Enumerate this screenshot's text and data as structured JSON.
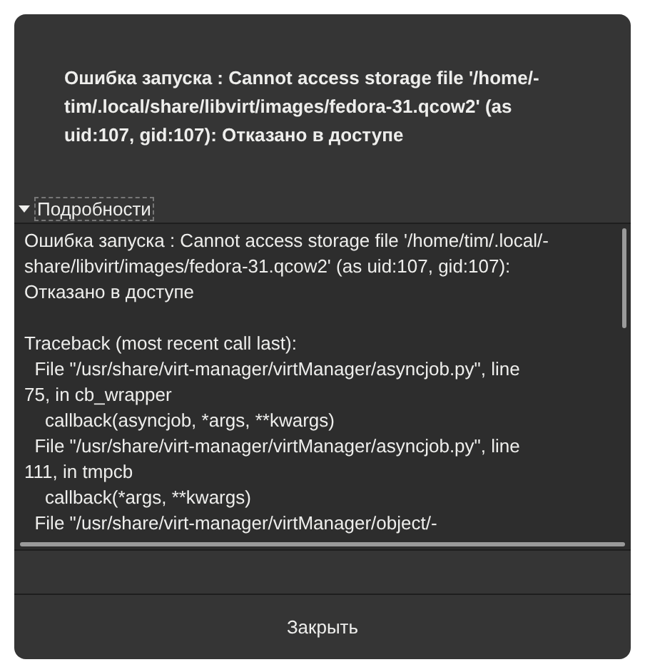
{
  "dialog": {
    "message": "Ошибка запуска : Cannot access storage file '/home/-\ntim/.local/share/libvirt/images/fedora-31.qcow2' (as\nuid:107, gid:107): Отказано в доступе",
    "details": {
      "label": "Подробности",
      "expanded": true,
      "text": "Ошибка запуска : Cannot access storage file '/home/tim/.local/-\nshare/libvirt/images/fedora-31.qcow2' (as uid:107, gid:107):\nОтказано в доступе\n\nTraceback (most recent call last):\n  File \"/usr/share/virt-manager/virtManager/asyncjob.py\", line\n75, in cb_wrapper\n    callback(asyncjob, *args, **kwargs)\n  File \"/usr/share/virt-manager/virtManager/asyncjob.py\", line\n111, in tmpcb\n    callback(*args, **kwargs)\n  File \"/usr/share/virt-manager/virtManager/object/-"
    },
    "buttons": [
      "Закрыть"
    ]
  }
}
